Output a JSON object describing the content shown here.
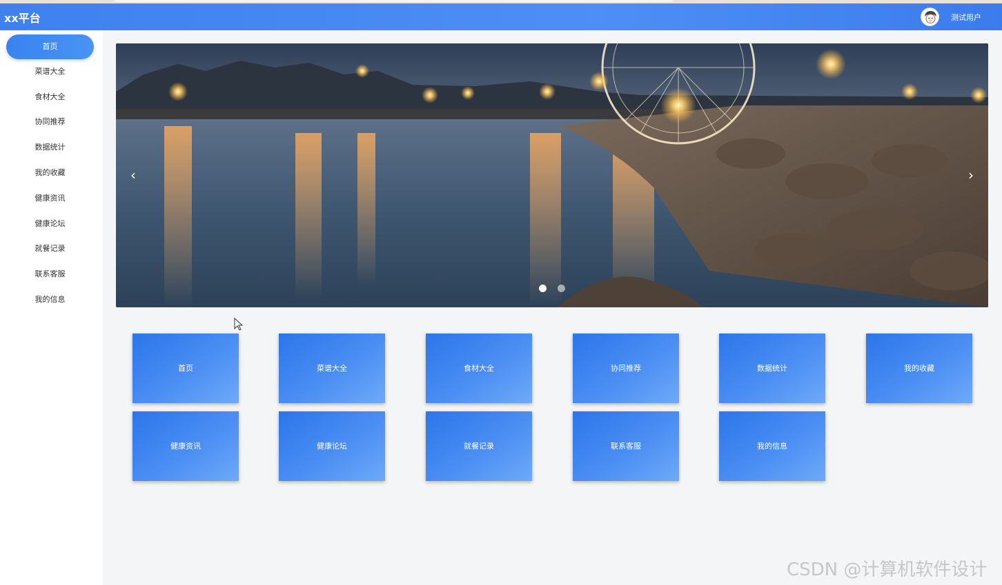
{
  "header": {
    "brand": "xx平台",
    "user_name": "测试用户"
  },
  "sidebar": {
    "items": [
      {
        "label": "首页",
        "active": true
      },
      {
        "label": "菜谱大全"
      },
      {
        "label": "食材大全"
      },
      {
        "label": "协同推荐"
      },
      {
        "label": "数据统计"
      },
      {
        "label": "我的收藏"
      },
      {
        "label": "健康资讯"
      },
      {
        "label": "健康论坛"
      },
      {
        "label": "就餐记录"
      },
      {
        "label": "联系客服"
      },
      {
        "label": "我的信息"
      }
    ]
  },
  "carousel": {
    "prev_icon": "‹",
    "next_icon": "›",
    "slide_count": 2,
    "active_slide": 1
  },
  "tiles": [
    {
      "label": "首页"
    },
    {
      "label": "菜谱大全"
    },
    {
      "label": "食材大全"
    },
    {
      "label": "协同推荐"
    },
    {
      "label": "数据统计"
    },
    {
      "label": "我的收藏"
    },
    {
      "label": "健康资讯"
    },
    {
      "label": "健康论坛"
    },
    {
      "label": "就餐记录"
    },
    {
      "label": "联系客服"
    },
    {
      "label": "我的信息"
    }
  ],
  "watermark": "CSDN @计算机软件设计",
  "colors": {
    "primary": "#3e81ef",
    "tile_start": "#2c76ea",
    "tile_end": "#6eaaf8"
  }
}
